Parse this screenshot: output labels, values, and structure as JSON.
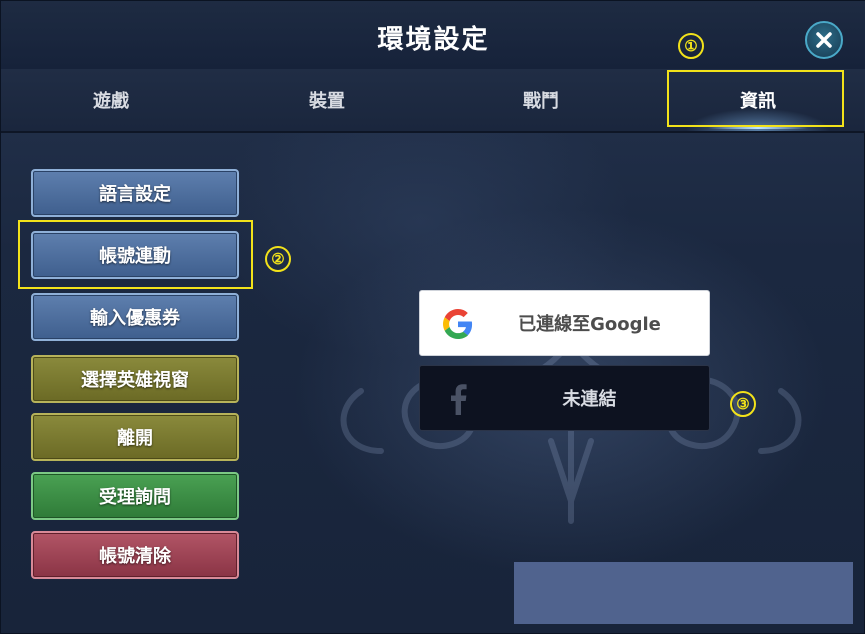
{
  "window": {
    "title": "環境設定"
  },
  "tabs": [
    {
      "label": "遊戲",
      "active": false
    },
    {
      "label": "裝置",
      "active": false
    },
    {
      "label": "戰鬥",
      "active": false
    },
    {
      "label": "資訊",
      "active": true
    }
  ],
  "markers": [
    "①",
    "②",
    "③"
  ],
  "menu": [
    {
      "label": "語言設定",
      "style": "blue"
    },
    {
      "label": "帳號連動",
      "style": "blue"
    },
    {
      "label": "輸入優惠券",
      "style": "blue"
    },
    {
      "label": "選擇英雄視窗",
      "style": "olive"
    },
    {
      "label": "離開",
      "style": "olive"
    },
    {
      "label": "受理詢問",
      "style": "green"
    },
    {
      "label": "帳號清除",
      "style": "red"
    }
  ],
  "account_links": {
    "google": {
      "label": "已連線至Google",
      "icon": "google-icon"
    },
    "facebook": {
      "label": "未連結",
      "icon": "facebook-icon"
    }
  },
  "icons": {
    "close": "close-icon"
  },
  "colors": {
    "marker": "#f2e21a",
    "accent": "#4aa9c8",
    "button_blue": "#4f6f9e",
    "button_olive": "#7a7a30",
    "button_green": "#3c8f45",
    "button_red": "#9e4455"
  }
}
